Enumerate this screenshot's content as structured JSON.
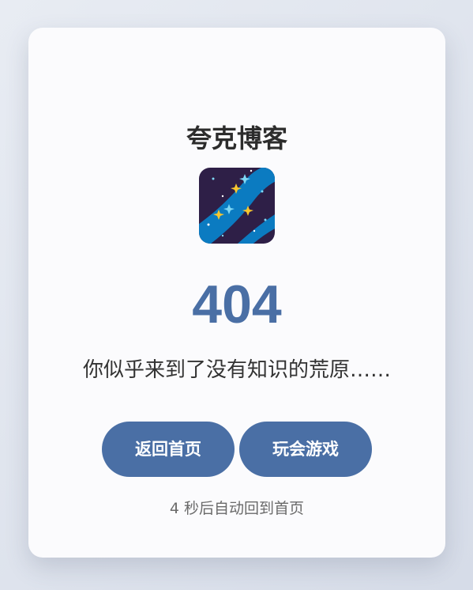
{
  "page": {
    "site_title": "夸克博客",
    "icon": "galaxy-icon",
    "error_code": "404",
    "message": "你似乎来到了没有知识的荒原……",
    "buttons": {
      "home_label": "返回首页",
      "game_label": "玩会游戏"
    },
    "countdown": "4 秒后自动回到首页"
  },
  "colors": {
    "accent": "#4a6fa5",
    "card_bg": "#fbfbfd",
    "icon_bg": "#2e1f47",
    "icon_stripe": "#0b7bc1",
    "star_yellow": "#f7c62f",
    "star_cyan": "#7fd8f5"
  }
}
